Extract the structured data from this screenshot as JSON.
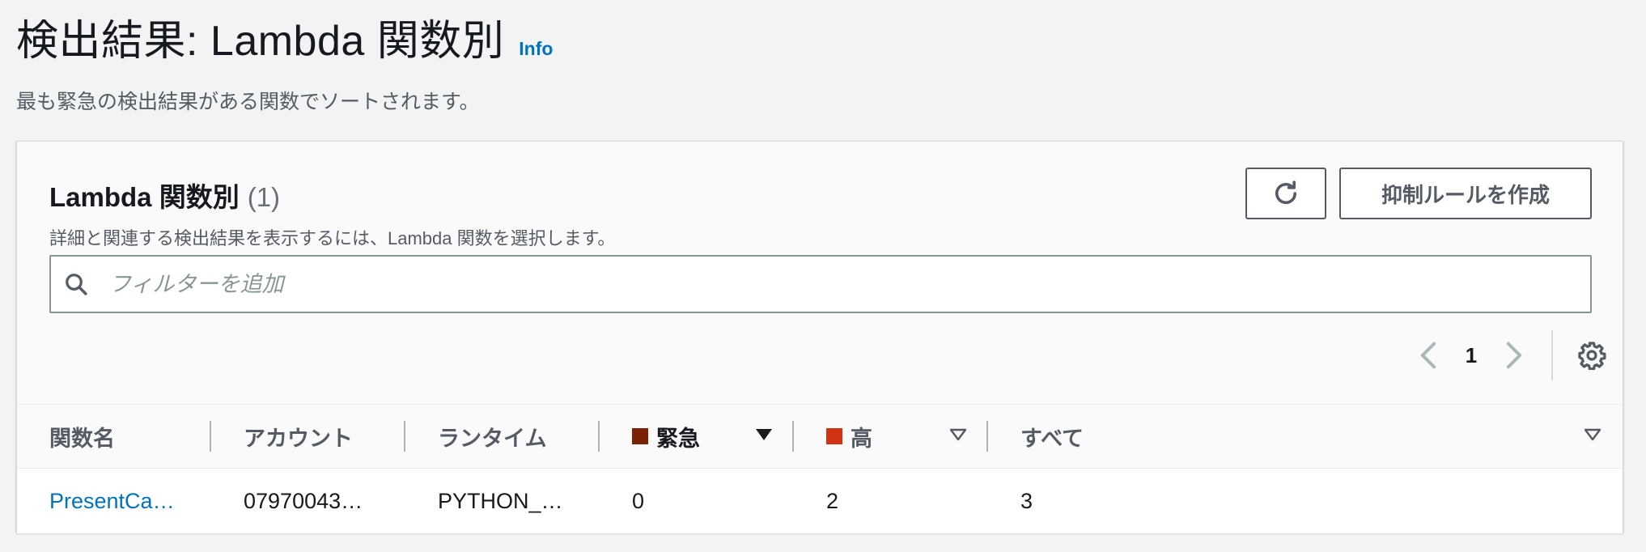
{
  "header": {
    "title": "検出結果: Lambda 関数別",
    "info_label": "Info",
    "description": "最も緊急の検出結果がある関数でソートされます。"
  },
  "panel": {
    "title": "Lambda 関数別",
    "count": "(1)",
    "description": "詳細と関連する検出結果を表示するには、Lambda 関数を選択します。",
    "refresh_icon": "refresh-icon",
    "create_rule_label": "抑制ルールを作成"
  },
  "filter": {
    "placeholder": "フィルターを追加",
    "value": ""
  },
  "pagination": {
    "current_page": "1"
  },
  "colors": {
    "critical": "#7d2105",
    "high": "#d13212",
    "link": "#0073bb"
  },
  "table": {
    "columns": [
      {
        "label": "関数名"
      },
      {
        "label": "アカウント"
      },
      {
        "label": "ランタイム"
      },
      {
        "label": "緊急",
        "sort": "descending"
      },
      {
        "label": "高",
        "sort": "sortable"
      },
      {
        "label": "すべて",
        "sort": "sortable"
      }
    ],
    "rows": [
      {
        "function_name": "PresentCa…",
        "account": "07970043…",
        "runtime": "PYTHON_…",
        "critical": "0",
        "high": "2",
        "all": "3"
      }
    ]
  }
}
